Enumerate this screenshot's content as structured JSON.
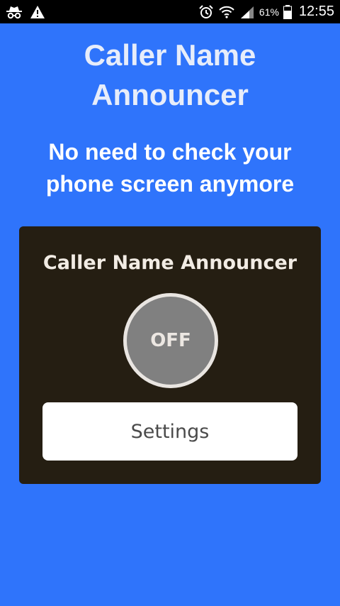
{
  "status_bar": {
    "icons_left": [
      "incognito-icon",
      "warning-icon"
    ],
    "icons_right": [
      "alarm-icon",
      "wifi-icon",
      "signal-icon",
      "battery-icon"
    ],
    "battery_percent": "61%",
    "time": "12:55"
  },
  "header": {
    "title_line1": "Caller Name",
    "title_line2": "Announcer",
    "subtitle_line1": "No need to check your",
    "subtitle_line2": "phone screen anymore"
  },
  "card": {
    "title": "Caller Name Announcer",
    "toggle_label": "OFF",
    "settings_label": "Settings"
  },
  "colors": {
    "background": "#2f74fb",
    "card_background": "#251e12",
    "toggle_fill": "#808080",
    "toggle_ring": "#e9e5e1"
  }
}
